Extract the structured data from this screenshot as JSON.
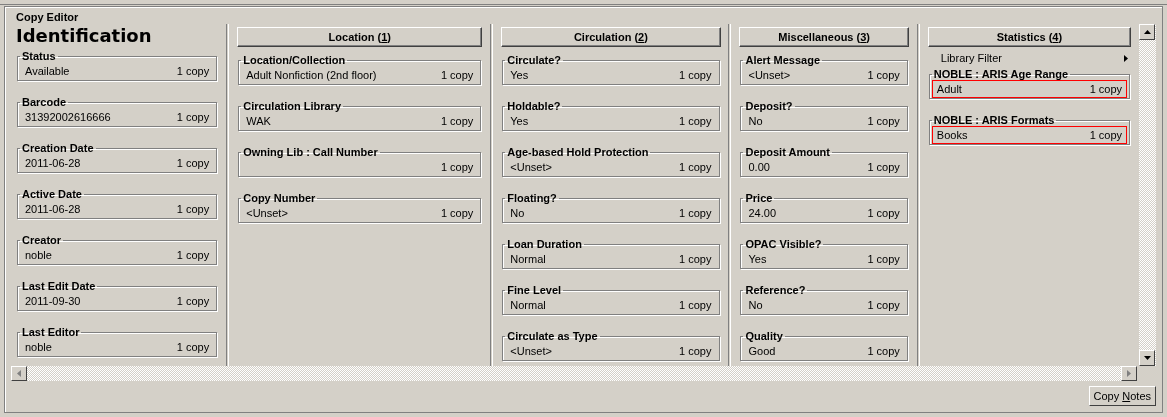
{
  "window": {
    "title": "Copy Editor"
  },
  "columns": [
    {
      "header": {
        "kind": "heading",
        "text": "Identification"
      },
      "fields": [
        {
          "label": "Status",
          "value": "Available",
          "count": "1 copy",
          "highlighted": false
        },
        {
          "label": "Barcode",
          "value": "31392002616666",
          "count": "1 copy",
          "highlighted": false
        },
        {
          "label": "Creation Date",
          "value": "2011-06-28",
          "count": "1 copy",
          "highlighted": false
        },
        {
          "label": "Active Date",
          "value": "2011-06-28",
          "count": "1 copy",
          "highlighted": false
        },
        {
          "label": "Creator",
          "value": "noble",
          "count": "1 copy",
          "highlighted": false
        },
        {
          "label": "Last Edit Date",
          "value": "2011-09-30",
          "count": "1 copy",
          "highlighted": false
        },
        {
          "label": "Last Editor",
          "value": "noble",
          "count": "1 copy",
          "highlighted": false
        }
      ]
    },
    {
      "header": {
        "kind": "button",
        "text_before": "Location (",
        "accesskey": "1",
        "text_after": ")"
      },
      "fields": [
        {
          "label": "Location/Collection",
          "value": "Adult Nonfiction (2nd floor)",
          "count": "1 copy",
          "highlighted": false
        },
        {
          "label": "Circulation Library",
          "value": "WAK",
          "count": "1 copy",
          "highlighted": false
        },
        {
          "label": "Owning Lib : Call Number",
          "count": "1 copy",
          "highlighted": false
        },
        {
          "label": "Copy Number",
          "value": "<Unset>",
          "count": "1 copy",
          "highlighted": false
        }
      ]
    },
    {
      "header": {
        "kind": "button",
        "text_before": "Circulation (",
        "accesskey": "2",
        "text_after": ")"
      },
      "fields": [
        {
          "label": "Circulate?",
          "value": "Yes",
          "count": "1 copy",
          "highlighted": false
        },
        {
          "label": "Holdable?",
          "value": "Yes",
          "count": "1 copy",
          "highlighted": false
        },
        {
          "label": "Age-based Hold Protection",
          "value": "<Unset>",
          "count": "1 copy",
          "highlighted": false
        },
        {
          "label": "Floating?",
          "value": "No",
          "count": "1 copy",
          "highlighted": false
        },
        {
          "label": "Loan Duration",
          "value": "Normal",
          "count": "1 copy",
          "highlighted": false
        },
        {
          "label": "Fine Level",
          "value": "Normal",
          "count": "1 copy",
          "highlighted": false
        },
        {
          "label": "Circulate as Type",
          "value": "<Unset>",
          "count": "1 copy",
          "highlighted": false
        }
      ]
    },
    {
      "header": {
        "kind": "button",
        "text_before": "Miscellaneous (",
        "accesskey": "3",
        "text_after": ")"
      },
      "fields": [
        {
          "label": "Alert Message",
          "value": "<Unset>",
          "count": "1 copy",
          "highlighted": false
        },
        {
          "label": "Deposit?",
          "value": "No",
          "count": "1 copy",
          "highlighted": false
        },
        {
          "label": "Deposit Amount",
          "value": "0.00",
          "count": "1 copy",
          "highlighted": false
        },
        {
          "label": "Price",
          "value": "24.00",
          "count": "1 copy",
          "highlighted": false
        },
        {
          "label": "OPAC Visible?",
          "value": "Yes",
          "count": "1 copy",
          "highlighted": false
        },
        {
          "label": "Reference?",
          "value": "No",
          "count": "1 copy",
          "highlighted": false
        },
        {
          "label": "Quality",
          "value": "Good",
          "count": "1 copy",
          "highlighted": false
        }
      ]
    },
    {
      "header": {
        "kind": "button",
        "text_before": "Statistics (",
        "accesskey": "4",
        "text_after": ")"
      },
      "filter": {
        "label": "Library Filter"
      },
      "fields": [
        {
          "label": "NOBLE : ARIS Age Range",
          "value": "Adult",
          "count": "1 copy",
          "highlighted": true
        },
        {
          "label": "NOBLE : ARIS Formats",
          "value": "Books",
          "count": "1 copy",
          "highlighted": true
        }
      ]
    }
  ],
  "buttons": [
    {
      "text_before": "Copy ",
      "accesskey": "N",
      "text_after": "otes"
    }
  ]
}
